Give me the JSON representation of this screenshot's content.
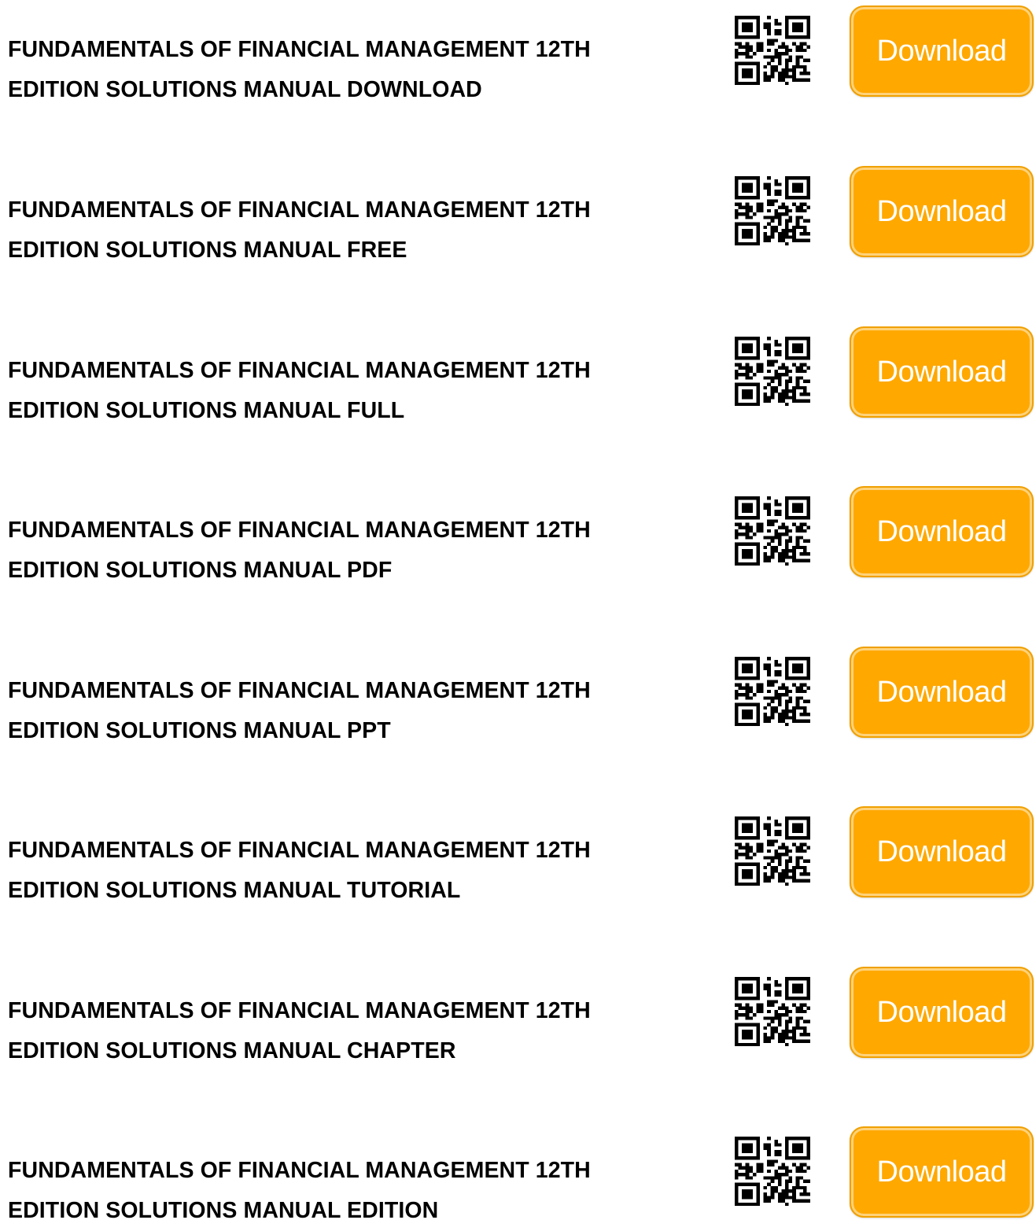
{
  "accent_color": "#ffa800",
  "items": [
    {
      "line1": "FUNDAMENTALS OF FINANCIAL MANAGEMENT 12TH",
      "line2": "EDITION SOLUTIONS MANUAL DOWNLOAD",
      "button_label": "Download"
    },
    {
      "line1": "FUNDAMENTALS OF FINANCIAL MANAGEMENT 12TH",
      "line2": "EDITION SOLUTIONS MANUAL FREE",
      "button_label": "Download"
    },
    {
      "line1": "FUNDAMENTALS OF FINANCIAL MANAGEMENT 12TH",
      "line2": "EDITION SOLUTIONS MANUAL FULL",
      "button_label": "Download"
    },
    {
      "line1": "FUNDAMENTALS OF FINANCIAL MANAGEMENT 12TH",
      "line2": "EDITION SOLUTIONS MANUAL PDF",
      "button_label": "Download"
    },
    {
      "line1": "FUNDAMENTALS OF FINANCIAL MANAGEMENT 12TH",
      "line2": "EDITION SOLUTIONS MANUAL PPT",
      "button_label": "Download"
    },
    {
      "line1": "FUNDAMENTALS OF FINANCIAL MANAGEMENT 12TH",
      "line2": "EDITION SOLUTIONS MANUAL TUTORIAL",
      "button_label": "Download"
    },
    {
      "line1": "FUNDAMENTALS OF FINANCIAL MANAGEMENT 12TH",
      "line2": "EDITION SOLUTIONS MANUAL CHAPTER",
      "button_label": "Download"
    },
    {
      "line1": "FUNDAMENTALS OF FINANCIAL MANAGEMENT 12TH",
      "line2": "EDITION SOLUTIONS MANUAL EDITION",
      "button_label": "Download"
    }
  ]
}
